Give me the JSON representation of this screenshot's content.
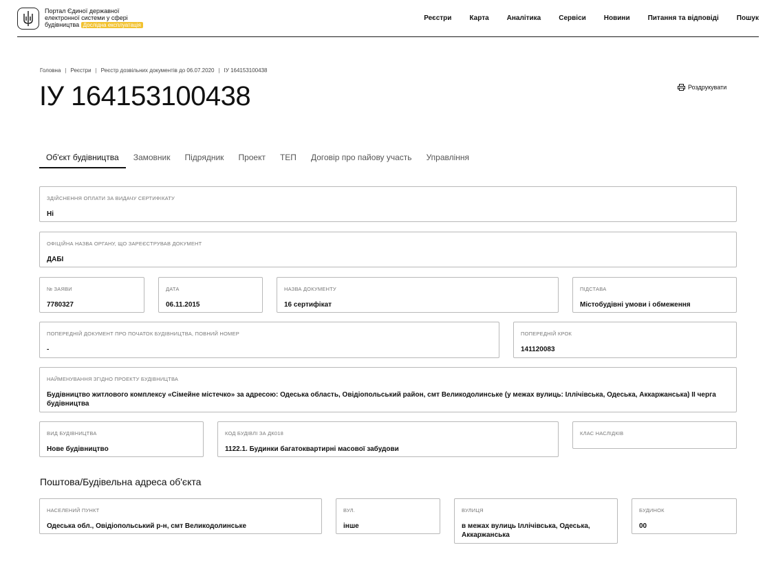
{
  "header": {
    "brand_line1": "Портал Єдиної державної",
    "brand_line2": "електронної системи у сфері",
    "brand_line3": "будівництва",
    "badge": "Дослідна експлуатація",
    "nav": [
      "Реєстри",
      "Карта",
      "Аналітика",
      "Сервіси",
      "Новини",
      "Питання та відповіді",
      "Пошук"
    ]
  },
  "breadcrumb": [
    "Головна",
    "Реєстри",
    "Реєстр дозвільних документів до 06.07.2020",
    "ІУ 164153100438"
  ],
  "title": "ІУ 164153100438",
  "print_label": "Роздрукувати",
  "tabs": [
    "Об'єкт будівництва",
    "Замовник",
    "Підрядник",
    "Проект",
    "ТЕП",
    "Договір про пайову участь",
    "Управління"
  ],
  "fields": {
    "payment": {
      "label": "Здійснення оплати за видачу сертифікату",
      "value": "Ні"
    },
    "authority": {
      "label": "Офіційна назва органу, що зареєстрував документ",
      "value": "ДАБІ"
    },
    "application_no": {
      "label": "№ заяви",
      "value": "7780327"
    },
    "date": {
      "label": "Дата",
      "value": "06.11.2015"
    },
    "doc_name": {
      "label": "Назва документу",
      "value": "16 сертифікат"
    },
    "basis": {
      "label": "Підстава",
      "value": "Містобудівні умови і обмеження"
    },
    "prev_doc": {
      "label": "Попередній документ про початок будівництва, повний номер",
      "value": "-"
    },
    "prev_step": {
      "label": "Попередній крок",
      "value": "141120083"
    },
    "project_name": {
      "label": "Найменування згідно проекту будівництва",
      "value": "Будівництво житлового комплексу «Сімейне містечко» за адресою: Одеська область, Овідіопольський район, смт Великодолинське (у межах вулиць: Іллічівська, Одеська, Аккаржанська) ІІ черга будівництва"
    },
    "build_type": {
      "label": "Вид будівництва",
      "value": "Нове будівництво"
    },
    "building_code": {
      "label": "Код будівлі за ДК018",
      "value": "1122.1. Будинки багатоквартирні масової забудови"
    },
    "consequence_class": {
      "label": "Клас наслідків",
      "value": ""
    }
  },
  "address_title": "Поштова/Будівельна адреса об'єкта",
  "address": {
    "settlement": {
      "label": "Населений пункт",
      "value": "Одеська обл., Овідіопольський р-н, смт Великодолинське"
    },
    "street_type": {
      "label": "Вул.",
      "value": "інше"
    },
    "street": {
      "label": "Вулиця",
      "value": "в межах вулиць Іллічівська, Одеська, Аккаржанська"
    },
    "house": {
      "label": "Будинок",
      "value": "00"
    }
  }
}
